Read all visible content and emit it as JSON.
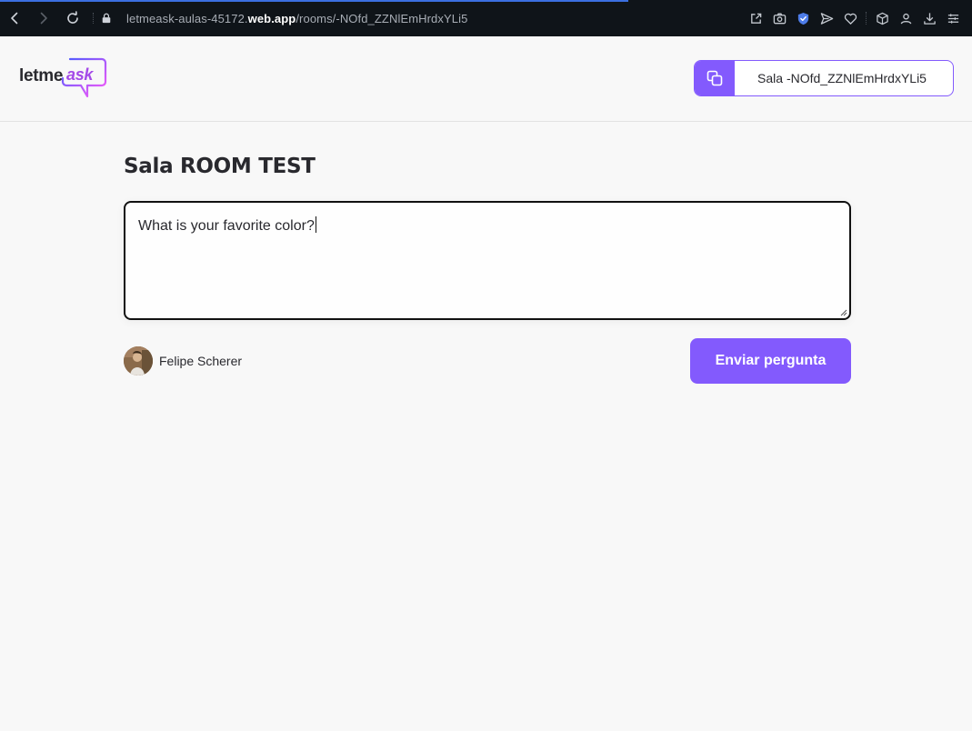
{
  "browser": {
    "url_prefix": "letmeask-aulas-45172.",
    "url_domain": "web.app",
    "url_path": "/rooms/-NOfd_ZZNlEmHrdxYLi5",
    "icons": [
      "back-icon",
      "forward-icon",
      "reload-icon",
      "lock-icon",
      "share-icon",
      "camera-icon",
      "shield-icon",
      "send-icon",
      "heart-icon",
      "cube-icon",
      "profile-icon",
      "download-icon",
      "menu-icon"
    ]
  },
  "header": {
    "logo_text_primary": "letme",
    "logo_text_accent": "ask",
    "room_code_label": "Sala -NOfd_ZZNlEmHrdxYLi5"
  },
  "main": {
    "room_title": "Sala ROOM TEST",
    "question_value": "What is your favorite color?",
    "user_name": "Felipe Scherer",
    "submit_label": "Enviar pergunta"
  },
  "colors": {
    "brand_purple": "#835afd",
    "logo_gradient_start": "#485bff",
    "logo_gradient_end": "#ff59f8",
    "text_dark": "#29292e",
    "page_background": "#f8f8f8",
    "browser_bar": "#0f1419"
  }
}
